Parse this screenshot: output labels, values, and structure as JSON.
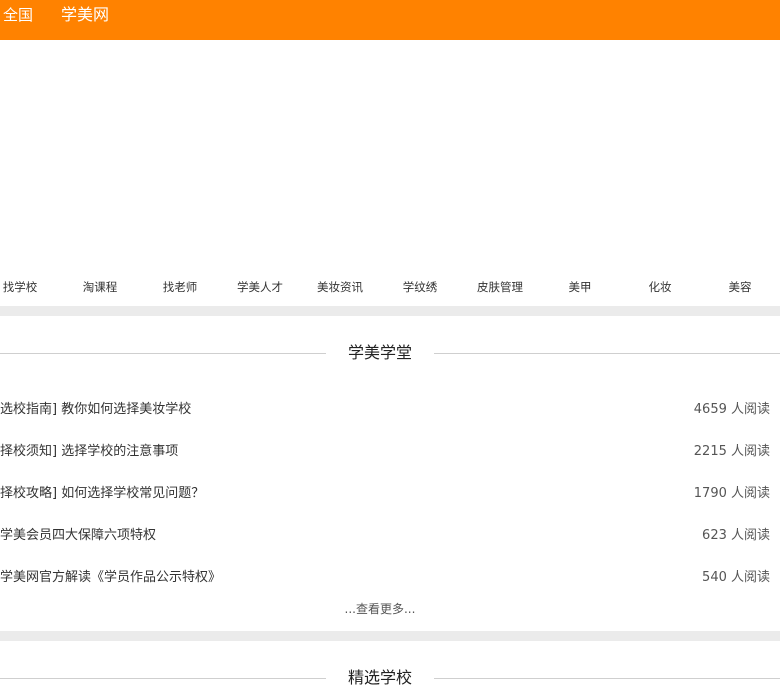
{
  "header": {
    "region": "全国",
    "brand": "学美网"
  },
  "nav": {
    "items": [
      "找学校",
      "淘课程",
      "找老师",
      "学美人才",
      "美妆资讯",
      "学纹绣",
      "皮肤管理",
      "美甲",
      "化妆",
      "美容"
    ]
  },
  "academy": {
    "title": "学美学堂",
    "articles": [
      {
        "title": "选校指南] 教你如何选择美妆学校",
        "reads": "4659 人阅读"
      },
      {
        "title": "择校须知] 选择学校的注意事项",
        "reads": "2215 人阅读"
      },
      {
        "title": "择校攻略] 如何选择学校常见问题？",
        "reads": "1790 人阅读"
      },
      {
        "title": "学美会员四大保障六项特权",
        "reads": "623 人阅读"
      },
      {
        "title": "学美网官方解读《学员作品公示特权》",
        "reads": "540 人阅读"
      }
    ],
    "more": "...查看更多..."
  },
  "featured": {
    "title": "精选学校"
  },
  "colors": {
    "accent": "#ff8200",
    "band": "#ebebeb"
  }
}
